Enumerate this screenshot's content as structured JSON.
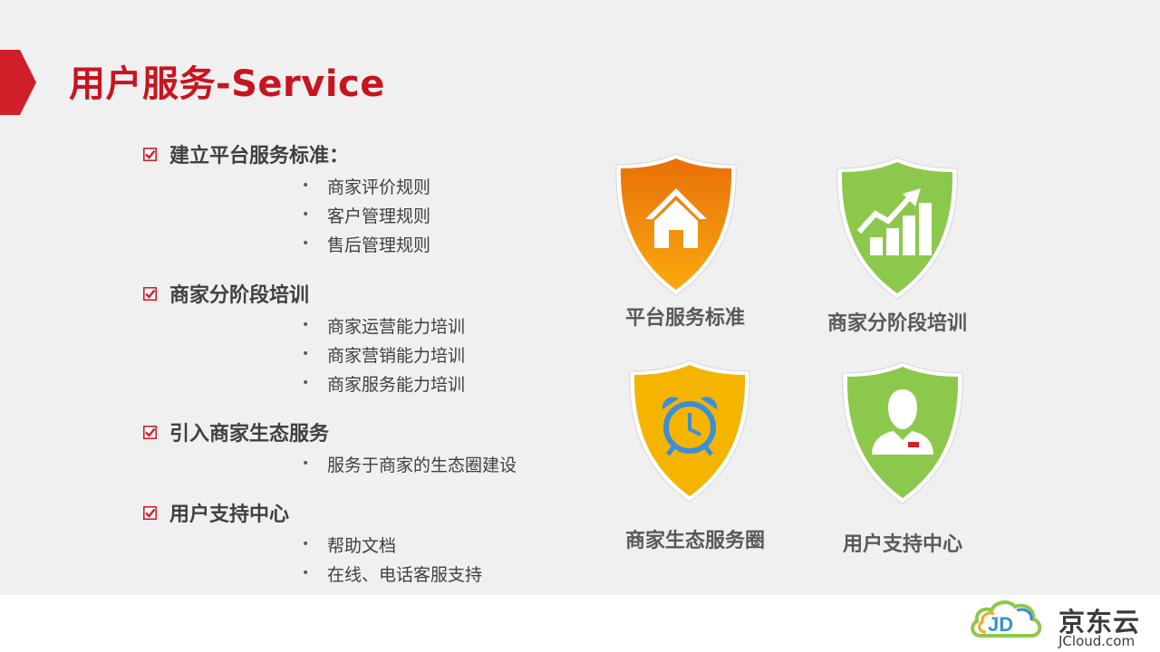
{
  "slide": {
    "title": "用户服务-Service",
    "accent_color": "#c8141e",
    "sections": [
      {
        "title": "建立平台服务标准：",
        "bullets": [
          "商家评价规则",
          "客户管理规则",
          "售后管理规则"
        ]
      },
      {
        "title": "商家分阶段培训",
        "bullets": [
          "商家运营能力培训",
          "商家营销能力培训",
          "商家服务能力培训"
        ]
      },
      {
        "title": "引入商家生态服务",
        "bullets": [
          "服务于商家的生态圈建设"
        ]
      },
      {
        "title": "用户支持中心",
        "bullets": [
          "帮助文档",
          "在线、电话客服支持"
        ]
      }
    ],
    "bullet_glyph": "•",
    "shields": [
      {
        "caption": "平台服务标准",
        "icon": "house-icon",
        "color": "#f08c0a"
      },
      {
        "caption": "商家分阶段培训",
        "icon": "growth-chart-icon",
        "color": "#8cc84b"
      },
      {
        "caption": "商家生态服务圈",
        "icon": "alarm-clock-icon",
        "color": "#f5b400"
      },
      {
        "caption": "用户支持中心",
        "icon": "user-icon",
        "color": "#8cc84b"
      }
    ]
  },
  "footer": {
    "logo_cn": "京东云",
    "logo_en": "JCloud.com",
    "logo_mark": "JD"
  }
}
